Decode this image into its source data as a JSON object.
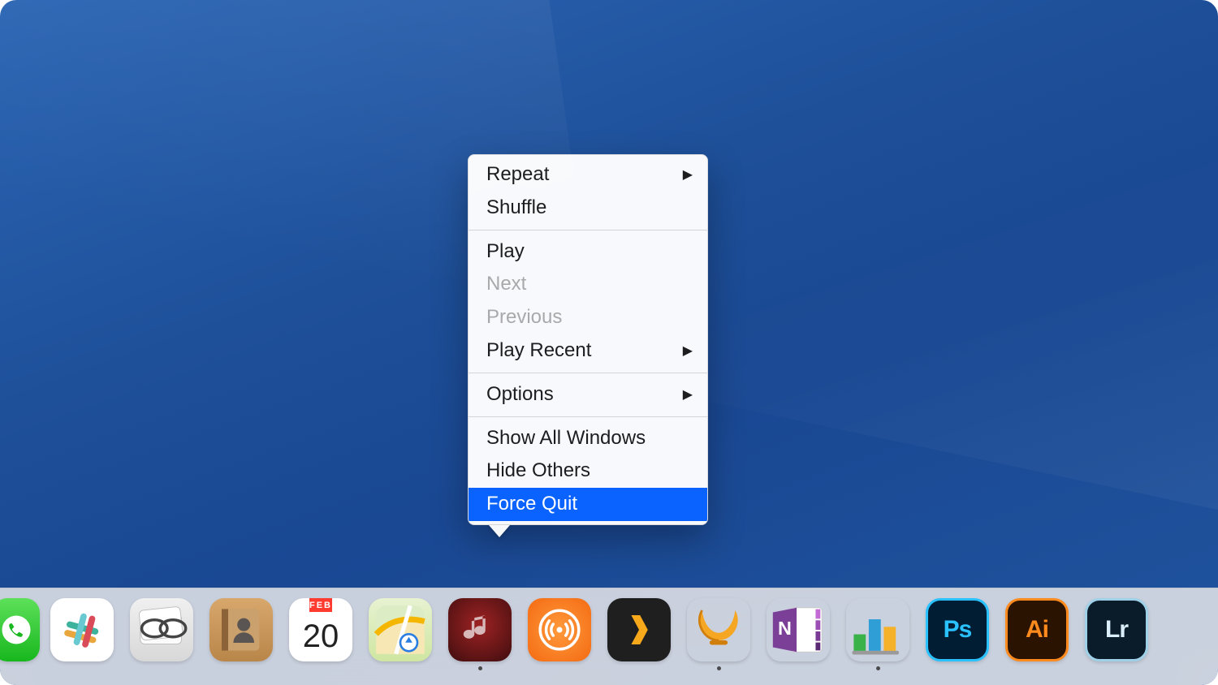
{
  "context_menu": {
    "source_app": "iTunes",
    "groups": [
      [
        {
          "label": "Repeat",
          "submenu": true,
          "disabled": false,
          "highlight": false
        },
        {
          "label": "Shuffle",
          "submenu": false,
          "disabled": false,
          "highlight": false
        }
      ],
      [
        {
          "label": "Play",
          "submenu": false,
          "disabled": false,
          "highlight": false
        },
        {
          "label": "Next",
          "submenu": false,
          "disabled": true,
          "highlight": false
        },
        {
          "label": "Previous",
          "submenu": false,
          "disabled": true,
          "highlight": false
        },
        {
          "label": "Play Recent",
          "submenu": true,
          "disabled": false,
          "highlight": false
        }
      ],
      [
        {
          "label": "Options",
          "submenu": true,
          "disabled": false,
          "highlight": false
        }
      ],
      [
        {
          "label": "Show All Windows",
          "submenu": false,
          "disabled": false,
          "highlight": false
        },
        {
          "label": "Hide Others",
          "submenu": false,
          "disabled": false,
          "highlight": false
        },
        {
          "label": "Force Quit",
          "submenu": false,
          "disabled": false,
          "highlight": true
        }
      ]
    ]
  },
  "calendar_icon": {
    "month": "FEB",
    "day": "20"
  },
  "adobe": {
    "ps": "Ps",
    "ai": "Ai",
    "lr": "Lr"
  },
  "dock": {
    "apps": [
      {
        "name": "FaceTime",
        "icon": "facetime-icon",
        "running": false
      },
      {
        "name": "Slack",
        "icon": "slack-icon",
        "running": false
      },
      {
        "name": "ReadKit",
        "icon": "readkit-icon",
        "running": false
      },
      {
        "name": "Contacts",
        "icon": "contacts-icon",
        "running": false
      },
      {
        "name": "Calendar",
        "icon": "calendar-icon",
        "running": false
      },
      {
        "name": "Maps",
        "icon": "maps-icon",
        "running": false
      },
      {
        "name": "iTunes",
        "icon": "itunes-icon",
        "running": true
      },
      {
        "name": "Overcast",
        "icon": "overcast-icon",
        "running": false
      },
      {
        "name": "Plex",
        "icon": "plex-icon",
        "running": false
      },
      {
        "name": "PrettyTunes",
        "icon": "lyre-icon",
        "running": true
      },
      {
        "name": "OneNote",
        "icon": "onenote-icon",
        "running": false
      },
      {
        "name": "Numbers",
        "icon": "numbers-icon",
        "running": true
      },
      {
        "name": "Photoshop",
        "icon": "photoshop-icon",
        "running": false
      },
      {
        "name": "Illustrator",
        "icon": "illustrator-icon",
        "running": false
      },
      {
        "name": "Lightroom",
        "icon": "lightroom-icon",
        "running": false
      }
    ]
  },
  "colors": {
    "menu_highlight": "#0a63ff",
    "desktop_blue": "#1d4e97"
  }
}
